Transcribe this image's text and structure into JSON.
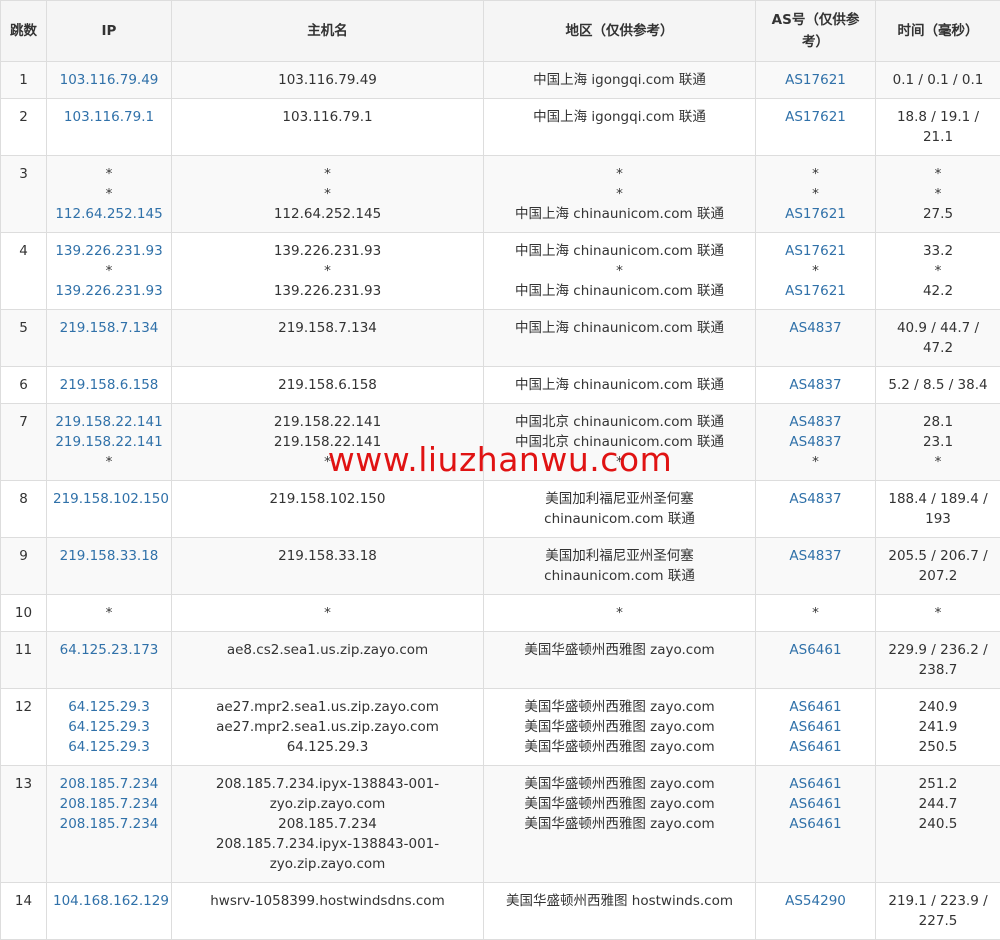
{
  "headers": [
    "跳数",
    "IP",
    "主机名",
    "地区（仅供参考）",
    "AS号（仅供参考）",
    "时间（毫秒）"
  ],
  "rows": [
    {
      "hop": "1",
      "ip": [
        "103.116.79.49"
      ],
      "host": [
        "103.116.79.49"
      ],
      "region": [
        "中国上海 igongqi.com 联通"
      ],
      "as": [
        "AS17621"
      ],
      "time": [
        "0.1 / 0.1 / 0.1"
      ]
    },
    {
      "hop": "2",
      "ip": [
        "103.116.79.1"
      ],
      "host": [
        "103.116.79.1"
      ],
      "region": [
        "中国上海 igongqi.com 联通"
      ],
      "as": [
        "AS17621"
      ],
      "time": [
        "18.8 / 19.1 / 21.1"
      ]
    },
    {
      "hop": "3",
      "ip": [
        "*",
        "*",
        "112.64.252.145"
      ],
      "host": [
        "*",
        "*",
        "112.64.252.145"
      ],
      "region": [
        "*",
        "*",
        "中国上海 chinaunicom.com 联通"
      ],
      "as": [
        "*",
        "*",
        "AS17621"
      ],
      "time": [
        "*",
        "*",
        "27.5"
      ]
    },
    {
      "hop": "4",
      "ip": [
        "139.226.231.93",
        "*",
        "139.226.231.93"
      ],
      "host": [
        "139.226.231.93",
        "*",
        "139.226.231.93"
      ],
      "region": [
        "中国上海 chinaunicom.com 联通",
        "*",
        "中国上海 chinaunicom.com 联通"
      ],
      "as": [
        "AS17621",
        "*",
        "AS17621"
      ],
      "time": [
        "33.2",
        "*",
        "42.2"
      ]
    },
    {
      "hop": "5",
      "ip": [
        "219.158.7.134"
      ],
      "host": [
        "219.158.7.134"
      ],
      "region": [
        "中国上海 chinaunicom.com 联通"
      ],
      "as": [
        "AS4837"
      ],
      "time": [
        "40.9 / 44.7 / 47.2"
      ]
    },
    {
      "hop": "6",
      "ip": [
        "219.158.6.158"
      ],
      "host": [
        "219.158.6.158"
      ],
      "region": [
        "中国上海 chinaunicom.com 联通"
      ],
      "as": [
        "AS4837"
      ],
      "time": [
        "5.2 / 8.5 / 38.4"
      ]
    },
    {
      "hop": "7",
      "ip": [
        "219.158.22.141",
        "219.158.22.141",
        "*"
      ],
      "host": [
        "219.158.22.141",
        "219.158.22.141",
        "*"
      ],
      "region": [
        "中国北京 chinaunicom.com 联通",
        "中国北京 chinaunicom.com 联通",
        "*"
      ],
      "as": [
        "AS4837",
        "AS4837",
        "*"
      ],
      "time": [
        "28.1",
        "23.1",
        "*"
      ]
    },
    {
      "hop": "8",
      "ip": [
        "219.158.102.150"
      ],
      "host": [
        "219.158.102.150"
      ],
      "region": [
        "美国加利福尼亚州圣何塞 chinaunicom.com 联通"
      ],
      "as": [
        "AS4837"
      ],
      "time": [
        "188.4 / 189.4 / 193"
      ]
    },
    {
      "hop": "9",
      "ip": [
        "219.158.33.18"
      ],
      "host": [
        "219.158.33.18"
      ],
      "region": [
        "美国加利福尼亚州圣何塞 chinaunicom.com 联通"
      ],
      "as": [
        "AS4837"
      ],
      "time": [
        "205.5 / 206.7 / 207.2"
      ]
    },
    {
      "hop": "10",
      "ip": [
        "*"
      ],
      "host": [
        "*"
      ],
      "region": [
        "*"
      ],
      "as": [
        "*"
      ],
      "time": [
        "*"
      ]
    },
    {
      "hop": "11",
      "ip": [
        "64.125.23.173"
      ],
      "host": [
        "ae8.cs2.sea1.us.zip.zayo.com"
      ],
      "region": [
        "美国华盛顿州西雅图 zayo.com"
      ],
      "as": [
        "AS6461"
      ],
      "time": [
        "229.9 / 236.2 / 238.7"
      ]
    },
    {
      "hop": "12",
      "ip": [
        "64.125.29.3",
        "64.125.29.3",
        "64.125.29.3"
      ],
      "host": [
        "ae27.mpr2.sea1.us.zip.zayo.com",
        "ae27.mpr2.sea1.us.zip.zayo.com",
        "64.125.29.3"
      ],
      "region": [
        "美国华盛顿州西雅图 zayo.com",
        "美国华盛顿州西雅图 zayo.com",
        "美国华盛顿州西雅图 zayo.com"
      ],
      "as": [
        "AS6461",
        "AS6461",
        "AS6461"
      ],
      "time": [
        "240.9",
        "241.9",
        "250.5"
      ]
    },
    {
      "hop": "13",
      "ip": [
        "208.185.7.234",
        "208.185.7.234",
        "208.185.7.234"
      ],
      "host": [
        "208.185.7.234.ipyx-138843-001-zyo.zip.zayo.com",
        "208.185.7.234",
        "208.185.7.234.ipyx-138843-001-zyo.zip.zayo.com"
      ],
      "region": [
        "美国华盛顿州西雅图 zayo.com",
        "美国华盛顿州西雅图 zayo.com",
        "美国华盛顿州西雅图 zayo.com"
      ],
      "as": [
        "AS6461",
        "AS6461",
        "AS6461"
      ],
      "time": [
        "251.2",
        "244.7",
        "240.5"
      ]
    },
    {
      "hop": "14",
      "ip": [
        "104.168.162.129"
      ],
      "host": [
        "hwsrv-1058399.hostwindsdns.com"
      ],
      "region": [
        "美国华盛顿州西雅图 hostwinds.com"
      ],
      "as": [
        "AS54290"
      ],
      "time": [
        "219.1 / 223.9 / 227.5"
      ]
    }
  ],
  "watermark": "www.liuzhanwu.com",
  "colors": {
    "link": "#3071a9",
    "watermark": "#e01313",
    "header_bg": "#f5f5f5",
    "stripe": "#f9f9f9",
    "border": "#dddddd"
  }
}
